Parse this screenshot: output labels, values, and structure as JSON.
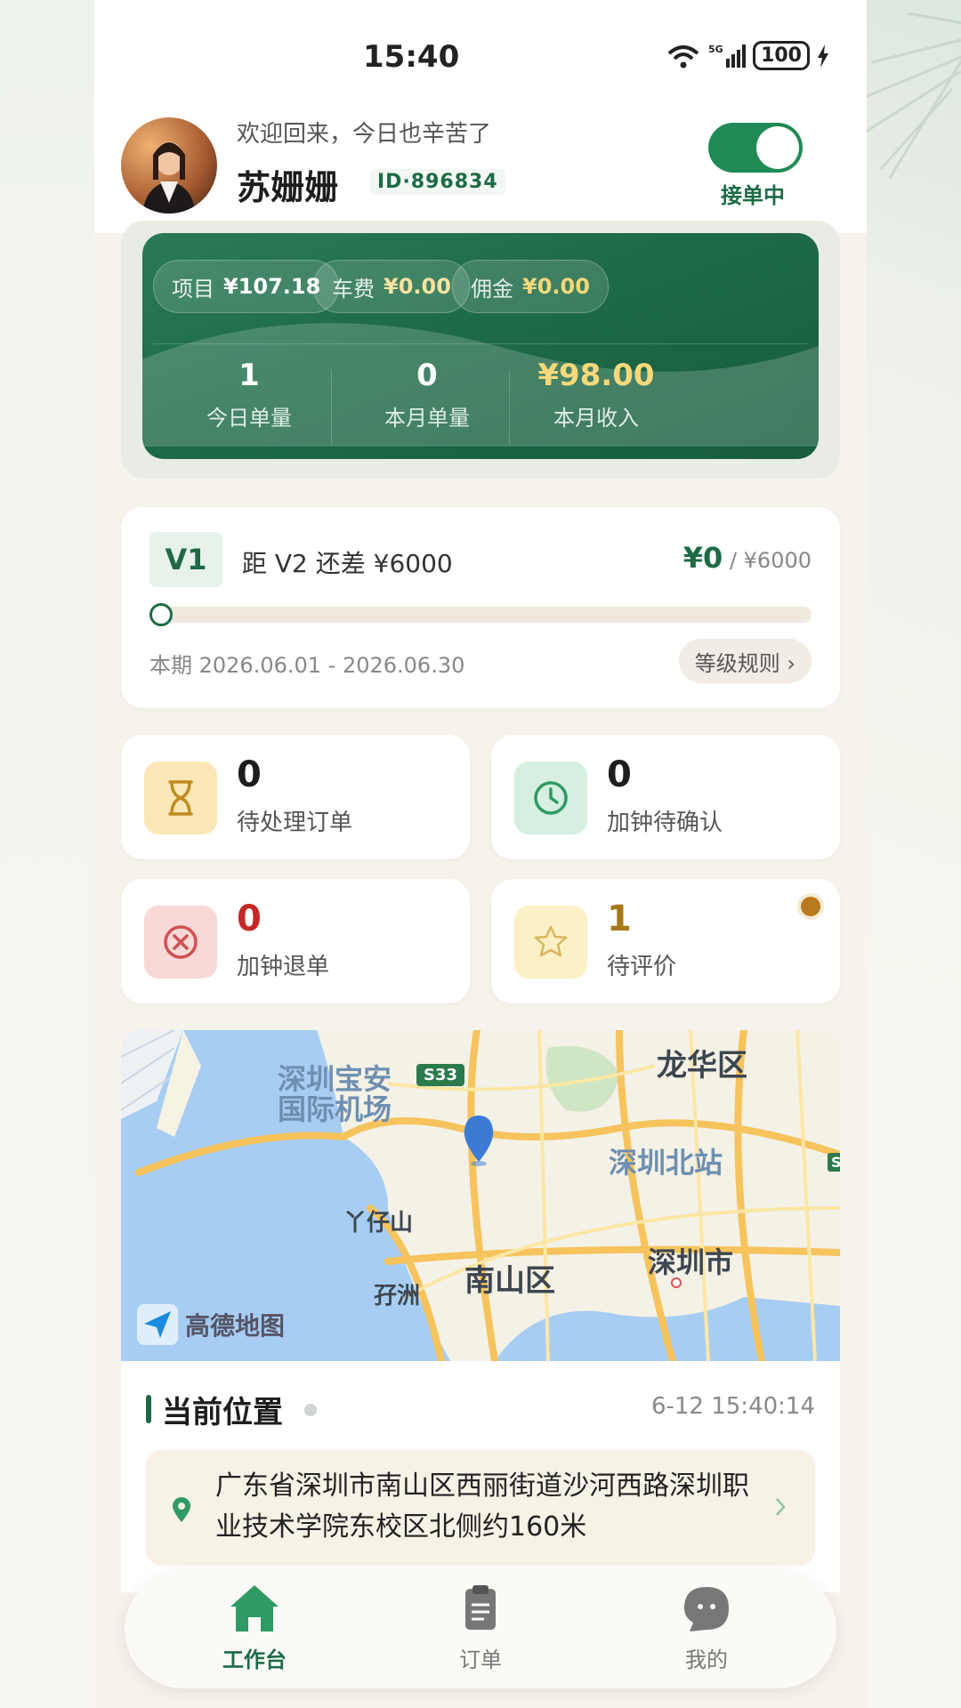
{
  "status_bar": {
    "time": "15:40",
    "signal": "5G",
    "wifi": "6",
    "battery": "100"
  },
  "header": {
    "welcome": "欢迎回来，今日也辛苦了",
    "name": "苏姗姗",
    "id_label": "ID·896834",
    "toggle_label": "接单中",
    "toggle_on": true
  },
  "earnings": {
    "pills": [
      {
        "label": "项目",
        "value": "¥107.18"
      },
      {
        "label": "车费",
        "value": "¥0.00"
      },
      {
        "label": "佣金",
        "value": "¥0.00"
      }
    ],
    "stats": [
      {
        "value": "1",
        "label": "今日单量"
      },
      {
        "value": "0",
        "label": "本月单量"
      },
      {
        "value": "¥98.00",
        "label": "本月收入"
      }
    ]
  },
  "level": {
    "badge": "V1",
    "text": "距 V2 还差 ¥6000",
    "current": "¥0",
    "target": "/ ¥6000",
    "progress": 0,
    "period": "本期 2026.06.01 - 2026.06.30",
    "rules_label": "等级规则 ›"
  },
  "tiles": [
    {
      "value": "0",
      "label": "待处理订单",
      "icon": "hourglass-icon"
    },
    {
      "value": "0",
      "label": "加钟待确认",
      "icon": "clock-icon"
    },
    {
      "value": "0",
      "label": "加钟退单",
      "icon": "cancel-icon"
    },
    {
      "value": "1",
      "label": "待评价",
      "icon": "star-icon"
    }
  ],
  "map": {
    "labels": {
      "airport1": "深圳宝安",
      "airport2": "国际机场",
      "s33": "S33",
      "longhua": "龙华区",
      "north_station": "深圳北站",
      "yazaishan": "丫仔山",
      "nanshan": "南山区",
      "shenzhen": "深圳市",
      "mazhou": "孖洲",
      "s_edge": "S"
    },
    "provider": "高德地图"
  },
  "location": {
    "title": "当前位置",
    "timestamp": "6-12 15:40:14",
    "address": "广东省深圳市南山区西丽街道沙河西路深圳职业技术学院东校区北侧约160米"
  },
  "nav": [
    {
      "label": "工作台",
      "icon": "home-icon",
      "active": true
    },
    {
      "label": "订单",
      "icon": "clipboard-icon",
      "active": false
    },
    {
      "label": "我的",
      "icon": "profile-icon",
      "active": false
    }
  ],
  "colors": {
    "brand": "#1d6b45",
    "accent_gold": "#f6d97a",
    "danger": "#c62828"
  }
}
